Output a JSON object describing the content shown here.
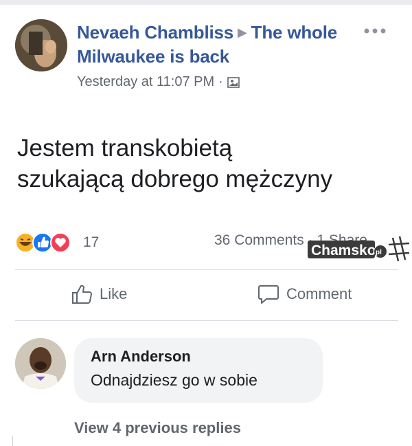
{
  "post": {
    "author": "Nevaeh Chambliss",
    "group": "The whole Milwaukee is back",
    "timestamp": "Yesterday at 11:07 PM",
    "separator": "·",
    "privacy_icon": "photo-privacy-icon",
    "more_icon": "ellipsis-icon",
    "text_line1": "Jestem transkobietą",
    "text_line2": "szukającą dobrego mężczyny"
  },
  "reactions": {
    "icons": [
      "haha-icon",
      "like-icon",
      "love-icon"
    ],
    "count": "17"
  },
  "stats": {
    "text": "36 Comments · 1 Share"
  },
  "watermark": {
    "text": "Chamsko",
    "suffix": "pl"
  },
  "actions": {
    "like_label": "Like",
    "comment_label": "Comment"
  },
  "comment": {
    "author": "Arn Anderson",
    "text": "Odnajdziesz go w sobie"
  },
  "replies": {
    "label": "View 4 previous replies"
  },
  "colors": {
    "link": "#365899",
    "secondary_text": "#616770",
    "bubble": "#f2f3f5",
    "divider": "#dadde1"
  }
}
